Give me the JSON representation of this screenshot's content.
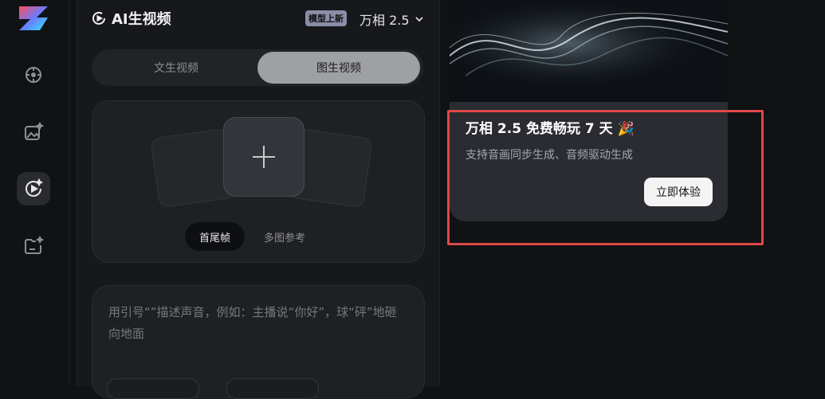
{
  "sidebar": {
    "logo": "z-logo",
    "items": [
      {
        "icon": "explore-icon",
        "active": false
      },
      {
        "icon": "image-gen-icon",
        "active": false
      },
      {
        "icon": "video-gen-icon",
        "active": true
      },
      {
        "icon": "assets-folder-icon",
        "active": false
      }
    ]
  },
  "panel": {
    "title": "AI生视频",
    "badge": "模型上新",
    "model": "万相 2.5",
    "tabs": [
      "文生视频",
      "图生视频"
    ],
    "active_tab": "图生视频",
    "upload": {
      "modes": [
        "首尾帧",
        "多图参考"
      ],
      "active_mode": "首尾帧"
    },
    "prompt_placeholder": "用引号“”描述声音，例如：主播说“你好”，球“砰”地砸向地面"
  },
  "promo": {
    "title": "万相 2.5 免费畅玩 7 天 🎉",
    "subtitle": "支持音画同步生成、音频驱动生成",
    "button": "立即体验"
  },
  "colors": {
    "highlight": "#e04848",
    "background": "#111214"
  }
}
